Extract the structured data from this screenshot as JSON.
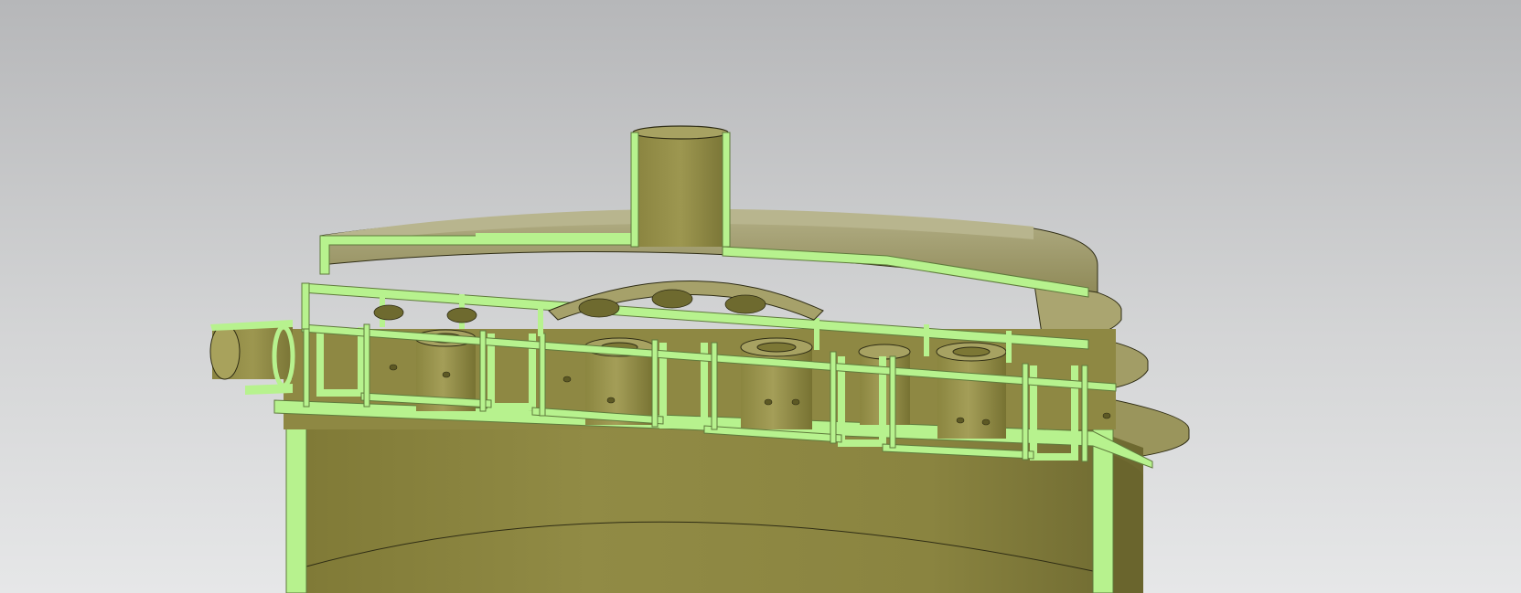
{
  "scene": {
    "description_visible_text": [],
    "colors": {
      "background_top": "#b6b7b9",
      "background_bottom": "#e6e7e8",
      "body": "#8d8742",
      "body_light": "#a6a05a",
      "body_dark": "#6f6a30",
      "section_cut": "#b7f28e",
      "edge": "#2e2c14"
    },
    "parts": [
      "inlet-pipe",
      "top-outlet-pipe",
      "upper-cover",
      "middle-flange",
      "lower-flange",
      "tube-sheet",
      "nozzle-cups",
      "vessel-shell"
    ]
  }
}
